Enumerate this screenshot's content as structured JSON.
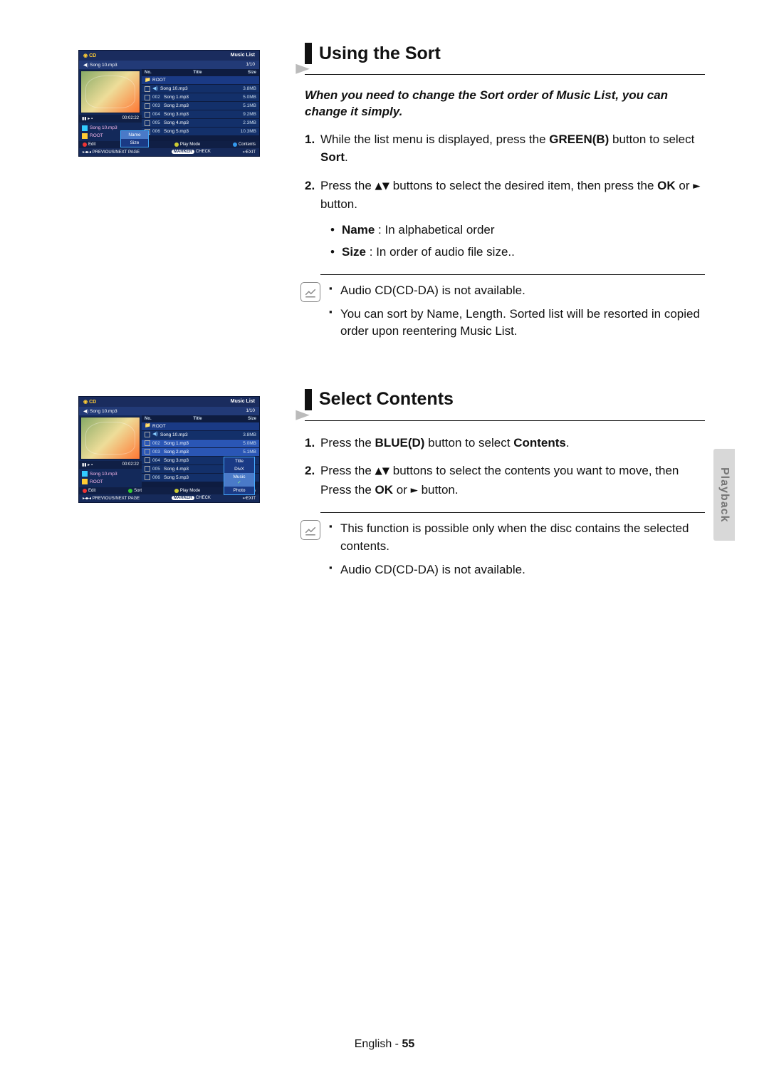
{
  "side_tab": "Playback",
  "footer_lang": "English",
  "footer_page": "55",
  "sections": {
    "sort": {
      "heading": "Using the Sort",
      "intro": "When you need to change the Sort order of Music List, you can change it simply.",
      "step1_num": "1.",
      "step1_a": "While the list menu is displayed, press the ",
      "step1_b": "GREEN(B)",
      "step1_c": " button to select ",
      "step1_d": "Sort",
      "step1_e": ".",
      "step2_num": "2.",
      "step2_a": "Press the ",
      "step2_arrows": "▲▼",
      "step2_b": " buttons to select the desired item, then press the ",
      "step2_ok": "OK",
      "step2_c": " or ",
      "step2_play": "►",
      "step2_d": " button.",
      "sub_name_label": "Name",
      "sub_name_text": " : In alphabetical order",
      "sub_size_label": "Size",
      "sub_size_text": " : In order of audio file size..",
      "note1": "Audio CD(CD-DA) is not available.",
      "note2": "You can sort by Name, Length. Sorted list will be resorted in copied order upon reentering Music List."
    },
    "contents": {
      "heading": "Select Contents",
      "step1_num": "1.",
      "step1_a": "Press the ",
      "step1_b": "BLUE(D)",
      "step1_c": " button to select ",
      "step1_d": "Contents",
      "step1_e": ".",
      "step2_num": "2.",
      "step2_a": "Press the ",
      "step2_arrows": "▲▼",
      "step2_b": " buttons to select the contents you want to move, then Press the ",
      "step2_ok": "OK",
      "step2_c": " or ",
      "step2_play": "►",
      "step2_d": " button.",
      "note1": "This function is possible only when the disc contains the selected contents.",
      "note2": "Audio CD(CD-DA) is not available."
    }
  },
  "tv": {
    "disc_label": "CD",
    "header_right": "Music List",
    "now_playing": "Song 10.mp3",
    "page_indicator": "1/10",
    "col_no": "No.",
    "col_title": "Title",
    "col_size": "Size",
    "root_label": "ROOT",
    "playback_controls": "▮▮ ▸ ▪",
    "timestamp": "00:02:22",
    "side_playing": "Song 10.mp3",
    "side_root": "ROOT",
    "rows": [
      {
        "num": "",
        "title": "Song 10.mp3",
        "size": "3.8MB",
        "play": true
      },
      {
        "num": "002",
        "title": "Song 1.mp3",
        "size": "5.0MB"
      },
      {
        "num": "003",
        "title": "Song 2.mp3",
        "size": "5.1MB"
      },
      {
        "num": "004",
        "title": "Song 3.mp3",
        "size": "9.2MB"
      },
      {
        "num": "005",
        "title": "Song 4.mp3",
        "size": "2.3MB"
      },
      {
        "num": "006",
        "title": "Song 5.mp3",
        "size": "10.3MB"
      }
    ],
    "sort_popup": {
      "opt1": "Name",
      "opt2": "Size"
    },
    "contents_popup": {
      "opt1": "Title",
      "opt2": "DivX",
      "opt3": "Music",
      "opt4": "Photo"
    },
    "btn_edit": "Edit",
    "btn_sort": "Sort",
    "btn_playmode": "Play Mode",
    "btn_contents": "Contents",
    "nav_prev": "PREVIOUS/NEXT PAGE",
    "nav_marker": "MARKER",
    "nav_check": "CHECK",
    "nav_exit": "EXIT",
    "nav_exit_icon": "↩"
  }
}
